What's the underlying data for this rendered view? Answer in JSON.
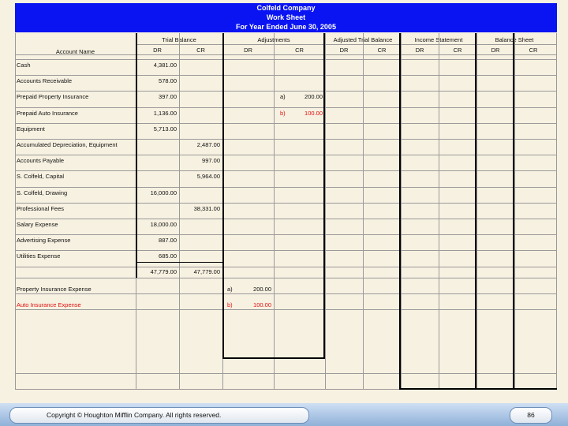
{
  "header": {
    "company": "Colfeld Company",
    "title": "Work Sheet",
    "period": "For Year Ended June 30, 2005"
  },
  "columns": {
    "account_name": "Account Name",
    "trial_balance": "Trial Balance",
    "adjustments": "Adjustments",
    "adjusted_trial_balance": "Adjusted Trial Balance",
    "income_statement": "Income Statement",
    "balance_sheet": "Balance Sheet",
    "dr": "DR",
    "cr": "CR"
  },
  "accounts": [
    {
      "name": "Cash",
      "tb_dr": "4,381.00",
      "tb_cr": "",
      "adj_label": "",
      "adj_cr": ""
    },
    {
      "name": "Accounts Receivable",
      "tb_dr": "578.00",
      "tb_cr": "",
      "adj_label": "",
      "adj_cr": ""
    },
    {
      "name": "Prepaid Property Insurance",
      "tb_dr": "397.00",
      "tb_cr": "",
      "adj_label": "a)",
      "adj_cr": "200.00"
    },
    {
      "name": "Prepaid Auto Insurance",
      "tb_dr": "1,136.00",
      "tb_cr": "",
      "adj_label": "b)",
      "adj_cr": "100.00"
    },
    {
      "name": "Equipment",
      "tb_dr": "5,713.00",
      "tb_cr": "",
      "adj_label": "",
      "adj_cr": ""
    },
    {
      "name": "Accumulated Depreciation, Equipment",
      "tb_dr": "",
      "tb_cr": "2,487.00",
      "adj_label": "",
      "adj_cr": ""
    },
    {
      "name": "Accounts Payable",
      "tb_dr": "",
      "tb_cr": "997.00",
      "adj_label": "",
      "adj_cr": ""
    },
    {
      "name": "S. Colfeld, Capital",
      "tb_dr": "",
      "tb_cr": "5,964.00",
      "adj_label": "",
      "adj_cr": ""
    },
    {
      "name": "S. Colfeld, Drawing",
      "tb_dr": "16,000.00",
      "tb_cr": "",
      "adj_label": "",
      "adj_cr": ""
    },
    {
      "name": "Professional Fees",
      "tb_dr": "",
      "tb_cr": "38,331.00",
      "adj_label": "",
      "adj_cr": ""
    },
    {
      "name": "Salary Expense",
      "tb_dr": "18,000.00",
      "tb_cr": "",
      "adj_label": "",
      "adj_cr": ""
    },
    {
      "name": "Advertising Expense",
      "tb_dr": "887.00",
      "tb_cr": "",
      "adj_label": "",
      "adj_cr": ""
    },
    {
      "name": "Utilities Expense",
      "tb_dr": "685.00",
      "tb_cr": "",
      "adj_label": "",
      "adj_cr": ""
    }
  ],
  "totals": {
    "tb_dr": "47,779.00",
    "tb_cr": "47,779.00"
  },
  "adjusting_entries": [
    {
      "name": "Property Insurance Expense",
      "label": "a)",
      "dr": "200.00"
    },
    {
      "name": "Auto Insurance Expense",
      "label": "b)",
      "dr": "100.00"
    }
  ],
  "footer": {
    "copyright": "Copyright © Houghton Mifflin Company. All rights reserved.",
    "page": "86"
  },
  "colors": {
    "header_bg": "#0a14f2",
    "highlight": "#e01010",
    "paper": "#f7f1e1"
  }
}
